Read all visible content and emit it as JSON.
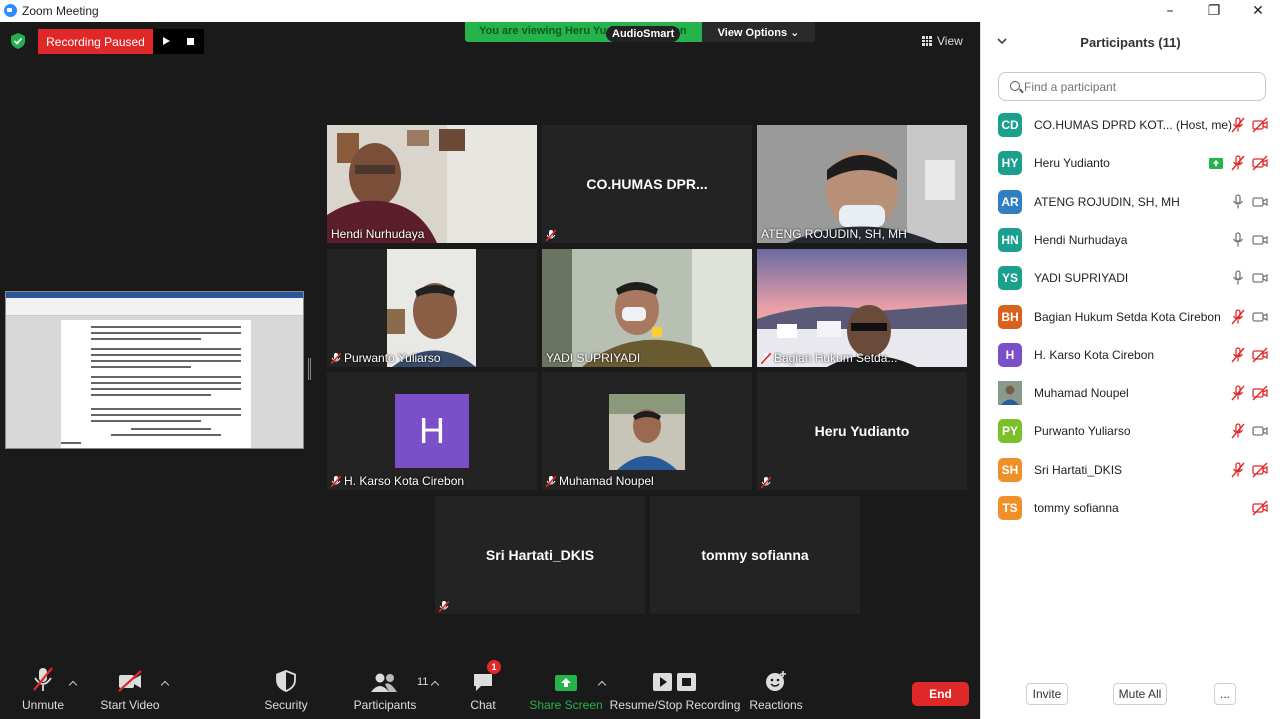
{
  "window": {
    "title": "Zoom Meeting",
    "minimize": "–",
    "maximize": "❐",
    "close": "✕"
  },
  "banner": {
    "viewing_text": "You are viewing Heru Yudianto's screen",
    "audiosmart": "AudioSmart",
    "view_options": "View Options ⌄"
  },
  "recording": {
    "status": "Recording Paused"
  },
  "view": {
    "label": "View"
  },
  "tiles": [
    {
      "name": "Hendi Nurhudaya",
      "muted": false,
      "video": true
    },
    {
      "name": "CO.HUMAS  DPR...",
      "muted": true,
      "video": false
    },
    {
      "name": "ATENG ROJUDIN, SH, MH",
      "muted": false,
      "video": true,
      "active": true
    },
    {
      "name": "Purwanto Yuliarso",
      "muted": true,
      "video": true
    },
    {
      "name": "YADI SUPRIYADI",
      "muted": false,
      "video": true
    },
    {
      "name": "Bagian Hukum Setda...",
      "muted": true,
      "video": true
    },
    {
      "name": "H. Karso Kota Cirebon",
      "muted": true,
      "video": false,
      "avatar_letter": "H"
    },
    {
      "name": "Muhamad Noupel",
      "muted": true,
      "video": true
    },
    {
      "name": "Heru Yudianto",
      "muted": true,
      "video": false
    },
    {
      "name": "Sri Hartati_DKIS",
      "muted": true,
      "video": false
    },
    {
      "name": "tommy sofianna",
      "muted": false,
      "video": false
    }
  ],
  "panel": {
    "title": "Participants (11)",
    "search_placeholder": "Find a participant",
    "participants": [
      {
        "initials": "CD",
        "name": "CO.HUMAS DPRD KOT... (Host, me)",
        "color": "#1aa08c",
        "share": false,
        "mic": "muted",
        "cam": "off"
      },
      {
        "initials": "HY",
        "name": "Heru Yudianto",
        "color": "#1aa08c",
        "share": true,
        "mic": "muted",
        "cam": "off"
      },
      {
        "initials": "AR",
        "name": "ATENG ROJUDIN, SH, MH",
        "color": "#2f7fc1",
        "share": false,
        "mic": "on",
        "cam": "on"
      },
      {
        "initials": "HN",
        "name": "Hendi Nurhudaya",
        "color": "#1aa08c",
        "share": false,
        "mic": "on",
        "cam": "on"
      },
      {
        "initials": "YS",
        "name": "YADI SUPRIYADI",
        "color": "#1aa08c",
        "share": false,
        "mic": "on",
        "cam": "on"
      },
      {
        "initials": "BH",
        "name": "Bagian Hukum Setda Kota Cirebon",
        "color": "#d8621c",
        "share": false,
        "mic": "muted",
        "cam": "on"
      },
      {
        "initials": "H",
        "name": "H. Karso Kota Cirebon",
        "color": "#7b4fc7",
        "share": false,
        "mic": "muted",
        "cam": "off"
      },
      {
        "initials": "",
        "name": "Muhamad Noupel",
        "color": "#6b7780",
        "share": false,
        "mic": "muted",
        "cam": "off"
      },
      {
        "initials": "PY",
        "name": "Purwanto Yuliarso",
        "color": "#7bbf2a",
        "share": false,
        "mic": "muted",
        "cam": "on"
      },
      {
        "initials": "SH",
        "name": "Sri Hartati_DKIS",
        "color": "#f0902a",
        "share": false,
        "mic": "muted",
        "cam": "off"
      },
      {
        "initials": "TS",
        "name": "tommy sofianna",
        "color": "#f0902a",
        "share": false,
        "mic": "none",
        "cam": "off"
      }
    ],
    "invite": "Invite",
    "mute_all": "Mute All",
    "more": "..."
  },
  "toolbar": {
    "unmute": "Unmute",
    "start_video": "Start Video",
    "security": "Security",
    "participants": "Participants",
    "participants_count": "11",
    "chat": "Chat",
    "chat_badge": "1",
    "share_screen": "Share Screen",
    "recording": "Resume/Stop Recording",
    "reactions": "Reactions",
    "end": "End"
  },
  "colors": {
    "accent_green": "#25b34b",
    "record_red": "#e02828",
    "active_speaker": "#d9e866"
  }
}
